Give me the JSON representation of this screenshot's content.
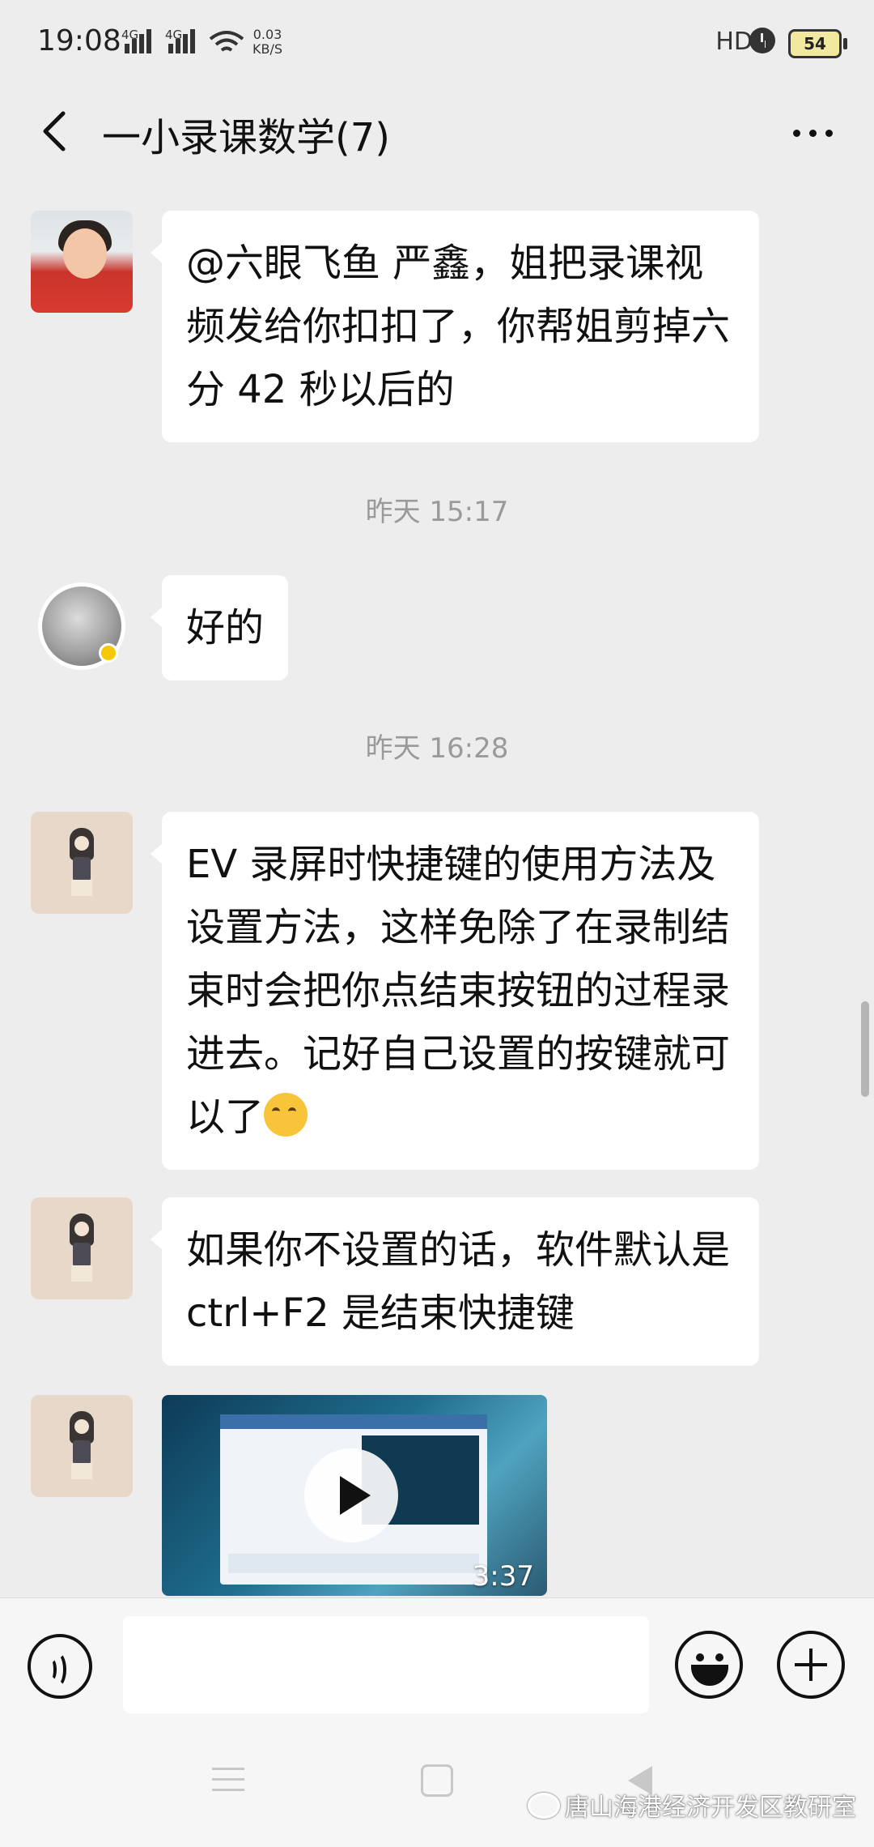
{
  "status_bar": {
    "time": "19:08",
    "network_1": "4G",
    "network_2": "4G",
    "speed": "0.03",
    "speed_unit": "KB/S",
    "hd": "HD",
    "battery": "54"
  },
  "header": {
    "title": "一小录课数学(7)",
    "back_icon": "chevron-left-icon",
    "more_icon": "more-horizontal-icon"
  },
  "messages": [
    {
      "type": "text",
      "avatar": "woman-photo",
      "text": "@六眼飞鱼  严鑫，姐把录课视频发给你扣扣了，你帮姐剪掉六分 42 秒以后的"
    },
    {
      "type": "timestamp",
      "text": "昨天 15:17"
    },
    {
      "type": "text",
      "avatar": "sketch-portrait",
      "text": "好的"
    },
    {
      "type": "timestamp",
      "text": "昨天 16:28"
    },
    {
      "type": "text",
      "avatar": "girl-illustration",
      "text": "EV 录屏时快捷键的使用方法及设置方法，这样免除了在录制结束时会把你点结束按钮的过程录进去。记好自己设置的按键就可以了",
      "emoji": "thinking-face"
    },
    {
      "type": "text",
      "avatar": "girl-illustration",
      "text": "如果你不设置的话，软件默认是 ctrl+F2 是结束快捷键"
    },
    {
      "type": "video",
      "avatar": "girl-illustration",
      "duration": "3:37"
    }
  ],
  "input_bar": {
    "voice_icon": "voice-icon",
    "placeholder": "",
    "emoji_icon": "smile-icon",
    "plus_icon": "plus-icon"
  },
  "nav_bar": {
    "watermark": "唐山海港经济开发区教研室"
  },
  "colors": {
    "background": "#ededed",
    "bubble": "#ffffff",
    "timestamp": "#9a9a9a"
  }
}
